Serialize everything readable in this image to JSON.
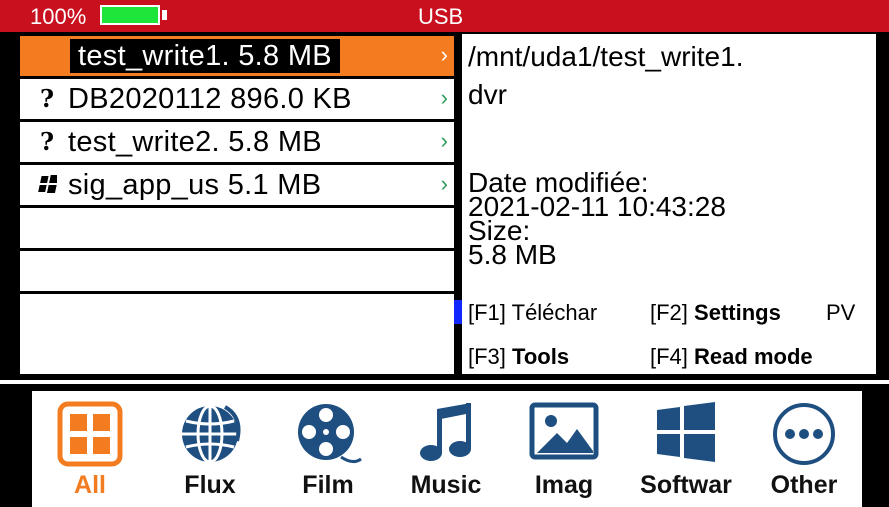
{
  "status": {
    "battery_pct": "100%",
    "title": "USB",
    "battery_color": "#1ee53a",
    "bar_color": "#c8101f"
  },
  "files": [
    {
      "icon": "video-file-icon",
      "glyph": "",
      "name": "test_write1. 5.8 MB",
      "selected": true
    },
    {
      "icon": "unknown-file-icon",
      "glyph": "?",
      "name": "DB2020112 896.0 KB",
      "selected": false
    },
    {
      "icon": "unknown-file-icon",
      "glyph": "?",
      "name": "test_write2. 5.8 MB",
      "selected": false
    },
    {
      "icon": "windows-file-icon",
      "glyph": "",
      "name": "sig_app_us 5.1 MB",
      "selected": false
    }
  ],
  "info": {
    "path_line1": "/mnt/uda1/test_write1.",
    "path_line2": "dvr",
    "date_label": "Date modifiée:",
    "date_value": "2021-02-11 10:43:28",
    "size_label": "Size:",
    "size_value": "5.8 MB"
  },
  "hints": {
    "f1_key": "[F1]",
    "f1_label": "Téléchar",
    "f2_key": "[F2]",
    "f2_label": "Settings",
    "pv": "PV",
    "f3_key": "[F3]",
    "f3_label": "Tools",
    "f4_key": "[F4]",
    "f4_label": "Read mode"
  },
  "categories": [
    {
      "label": "All",
      "icon": "grid-icon",
      "active": true
    },
    {
      "label": "Flux",
      "icon": "globe-icon",
      "active": false
    },
    {
      "label": "Film",
      "icon": "film-reel-icon",
      "active": false
    },
    {
      "label": "Music",
      "icon": "music-note-icon",
      "active": false
    },
    {
      "label": "Imag",
      "icon": "image-icon",
      "active": false
    },
    {
      "label": "Softwar",
      "icon": "windows-icon",
      "active": false
    },
    {
      "label": "Other",
      "icon": "more-icon",
      "active": false
    }
  ],
  "colors": {
    "accent": "#f47c20",
    "icon_blue": "#1e4f80"
  }
}
